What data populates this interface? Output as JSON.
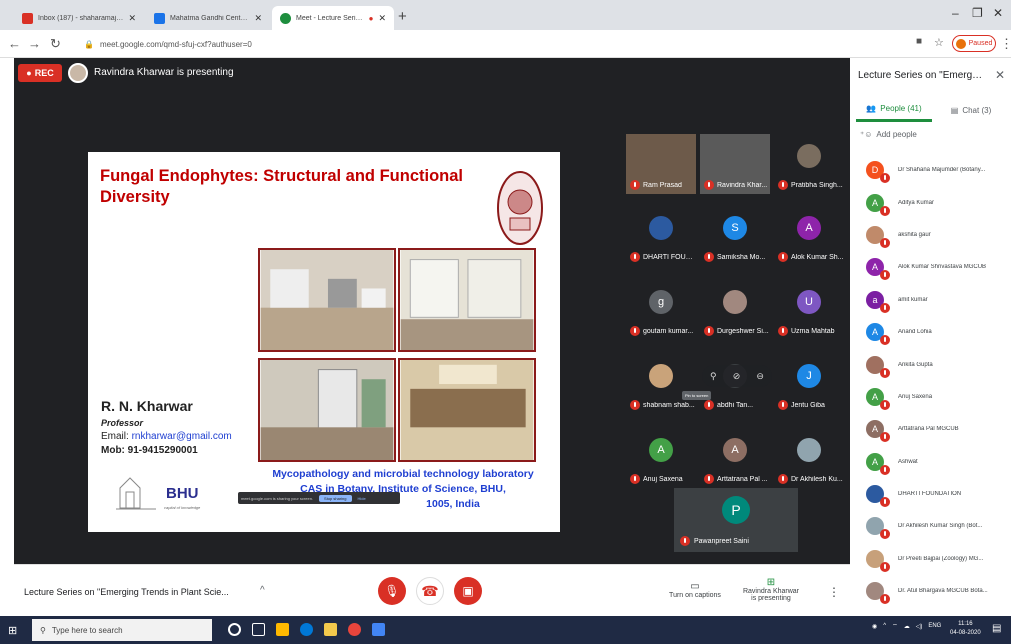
{
  "browser": {
    "tabs": [
      {
        "title": "Inbox (187) - shaharamajumder",
        "color": "#d93025",
        "active": false
      },
      {
        "title": "Mahatma Gandhi Central Univers",
        "color": "#1a73e8",
        "active": false
      },
      {
        "title": "Meet - Lecture Series on \"Em",
        "color": "#1e8e3e",
        "active": true
      }
    ],
    "url": "meet.google.com/qmd-sfuj-cxf?authuser=0",
    "paused_label": "Paused"
  },
  "meet": {
    "rec_label": "REC",
    "presenting_text": "Ravindra Kharwar is presenting",
    "slide": {
      "title": "Fungal Endophytes: Structural and Functional Diversity",
      "name": "R. N. Kharwar",
      "role": "Professor",
      "email_label": "Email: ",
      "email": "rnkharwar@gmail.com",
      "mobile": "Mob:  91-9415290001",
      "lab_line1": "Mycopathology and microbial technology laboratory",
      "lab_line2": "CAS in Botany, Institute of Science, BHU,",
      "lab_line3": "1005, India",
      "bhu_label": "BHU",
      "bhu_tagline": "capital of knowledge",
      "share_text": "meet.google.com is sharing your screen.",
      "stop_sharing": "Stop sharing",
      "hide": "Hide"
    },
    "tiles": [
      {
        "name": "Ram Prasad",
        "initial": "",
        "color": "#6d5a4a",
        "video": true
      },
      {
        "name": "Ravindra Khar...",
        "initial": "",
        "color": "#5a5a5a",
        "video": true
      },
      {
        "name": "Pratibha Singh...",
        "initial": "",
        "color": "#7a6d5f",
        "video": false
      },
      {
        "name": "DHARTI FOUN...",
        "initial": "",
        "color": "#2c5aa0",
        "video": false
      },
      {
        "name": "Samiksha Mo...",
        "initial": "S",
        "color": "#1e88e5",
        "video": false
      },
      {
        "name": "Alok Kumar Sh...",
        "initial": "A",
        "color": "#8e24aa",
        "video": false
      },
      {
        "name": "goutam kumar...",
        "initial": "g",
        "color": "#5f6368",
        "video": false
      },
      {
        "name": "Durgeshwer Si...",
        "initial": "",
        "color": "#a1887f",
        "video": false
      },
      {
        "name": "Uzma Mahtab",
        "initial": "U",
        "color": "#7e57c2",
        "video": false
      },
      {
        "name": "shabnam shab...",
        "initial": "",
        "color": "#c9a37a",
        "video": false
      },
      {
        "name": "abdhi Tan...",
        "initial": "",
        "color": "#3c4043",
        "video": false
      },
      {
        "name": "Jentu Giba",
        "initial": "J",
        "color": "#1e88e5",
        "video": false
      },
      {
        "name": "Anuj Saxena",
        "initial": "A",
        "color": "#43a047",
        "video": false
      },
      {
        "name": "Arttatrana Pal ...",
        "initial": "A",
        "color": "#8d6e63",
        "video": false
      },
      {
        "name": "Dr Akhilesh Ku...",
        "initial": "",
        "color": "#90a4ae",
        "video": false
      }
    ],
    "pin_tooltip": "Pin to screen",
    "big_tile": {
      "name": "Pawanpreet Saini",
      "initial": "P",
      "color": "#00897b"
    }
  },
  "panel": {
    "title": "Lecture Series on \"Emerging...",
    "people_tab": "People (41)",
    "chat_tab": "Chat (3)",
    "add_people": "Add people",
    "people": [
      {
        "name": "Dr Shahana Majumder (Botany...",
        "initial": "D",
        "color": "#f4511e"
      },
      {
        "name": "Aditya Kumar",
        "initial": "A",
        "color": "#43a047"
      },
      {
        "name": "akshita gaur",
        "initial": "",
        "color": "#c08a6a"
      },
      {
        "name": "Alok Kumar Shrivastava MGCUB",
        "initial": "A",
        "color": "#8e24aa"
      },
      {
        "name": "amit kumar",
        "initial": "a",
        "color": "#7b1fa2"
      },
      {
        "name": "Anand Lohia",
        "initial": "A",
        "color": "#1e88e5"
      },
      {
        "name": "Ankita Gupta",
        "initial": "",
        "color": "#a07060"
      },
      {
        "name": "Anuj Saxena",
        "initial": "A",
        "color": "#43a047"
      },
      {
        "name": "Arttatrana Pal MGCUB",
        "initial": "A",
        "color": "#8d6e63"
      },
      {
        "name": "Ashwat",
        "initial": "A",
        "color": "#43a047"
      },
      {
        "name": "DHARTI FOUNDATION",
        "initial": "",
        "color": "#2c5aa0"
      },
      {
        "name": "Dr Akhilesh Kumar Singh (Bot...",
        "initial": "",
        "color": "#90a4ae"
      },
      {
        "name": "Dr Preeti Bajpai (Zoology) MG...",
        "initial": "",
        "color": "#c7a07a"
      },
      {
        "name": "Dr. Atul Bhargava MGCUB Bota...",
        "initial": "",
        "color": "#a1887f"
      }
    ]
  },
  "controls": {
    "meeting_title": "Lecture Series on \"Emerging Trends in Plant Scie...",
    "captions_label": "Turn on captions",
    "present_line1": "Ravindra Kharwar",
    "present_line2": "is presenting"
  },
  "taskbar": {
    "search_placeholder": "Type here to search",
    "lang": "ENG",
    "time": "11:16",
    "date": "04-08-2020"
  }
}
